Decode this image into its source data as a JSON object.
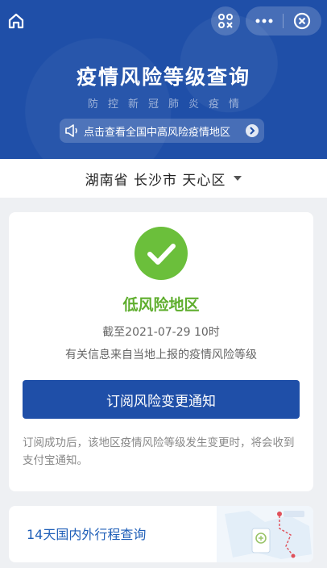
{
  "header": {
    "title": "疫情风险等级查询",
    "subtitle": "防控新冠肺炎疫情",
    "notice": "点击查看全国中高风险疫情地区"
  },
  "toolbar": {
    "home_icon": "home-icon",
    "scan_icon": "scan-icon",
    "more_icon": "more-icon",
    "close_icon": "close-icon"
  },
  "region": {
    "label": "湖南省 长沙市 天心区"
  },
  "result": {
    "level": "低风险地区",
    "as_of": "截至2021-07-29 10时",
    "source": "有关信息来自当地上报的疫情风险等级",
    "subscribe_label": "订阅风险变更通知",
    "tip": "订阅成功后，该地区疫情风险等级发生变更时，将会收到支付宝通知。"
  },
  "trip": {
    "label": "14天国内外行程查询"
  },
  "colors": {
    "primary": "#1f4fa8",
    "success": "#6bbf3b"
  }
}
